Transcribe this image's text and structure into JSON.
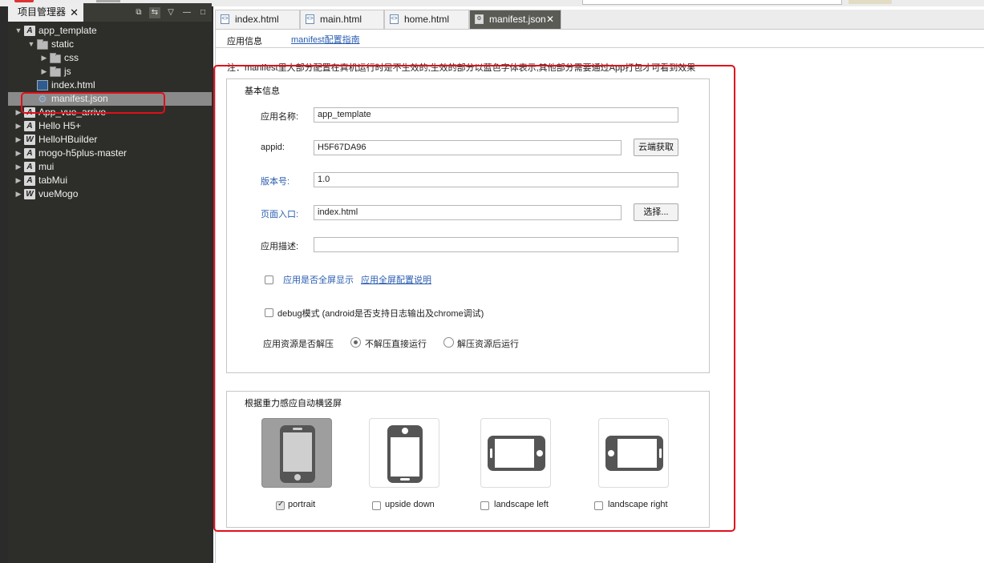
{
  "project_panel": {
    "title": "项目管理器",
    "tools": [
      "⧉",
      "⇆",
      "▽",
      "—",
      "□"
    ],
    "tree": [
      {
        "label": "app_template",
        "icon": "project-icon",
        "badge": "A",
        "expanded": true
      },
      {
        "label": "static",
        "icon": "folder-icon",
        "expanded": true
      },
      {
        "label": "css",
        "icon": "folder-icon",
        "expanded": false
      },
      {
        "label": "js",
        "icon": "folder-icon",
        "expanded": false
      },
      {
        "label": "index.html",
        "icon": "html-file-icon"
      },
      {
        "label": "manifest.json",
        "icon": "json-file-icon",
        "selected": true
      },
      {
        "label": "App_vue_arrive",
        "icon": "project-icon",
        "badge": "A",
        "expanded": false
      },
      {
        "label": "Hello H5+",
        "icon": "project-icon",
        "badge": "A",
        "expanded": false
      },
      {
        "label": "HelloHBuilder",
        "icon": "project-icon",
        "badge": "W",
        "expanded": false
      },
      {
        "label": "mogo-h5plus-master",
        "icon": "project-icon",
        "badge": "A",
        "expanded": false
      },
      {
        "label": "mui",
        "icon": "project-icon",
        "badge": "A",
        "expanded": false
      },
      {
        "label": "tabMui",
        "icon": "project-icon",
        "badge": "A",
        "expanded": false
      },
      {
        "label": "vueMogo",
        "icon": "project-icon",
        "badge": "W",
        "expanded": false
      }
    ]
  },
  "editor_tabs": [
    {
      "label": "index.html",
      "active": false
    },
    {
      "label": "main.html",
      "active": false
    },
    {
      "label": "home.html",
      "active": false
    },
    {
      "label": "manifest.json",
      "active": true,
      "close": "✕"
    }
  ],
  "manifest": {
    "subtab": "应用信息",
    "guide_link": "manifest配置指南",
    "note": "注：manifest里大部分配置在真机运行时是不生效的,生效的部分以蓝色字体表示,其他部分需要通过App打包才可看到效果",
    "basic": {
      "title": "基本信息",
      "app_name_label": "应用名称:",
      "app_name_value": "app_template",
      "appid_label": "appid:",
      "appid_value": "H5F67DA96",
      "cloud_button": "云端获取",
      "version_label": "版本号:",
      "version_value": "1.0",
      "entry_label": "页面入口:",
      "entry_value": "index.html",
      "choose_button": "选择...",
      "desc_label": "应用描述:",
      "desc_value": "",
      "fullscreen_label": "应用是否全屏显示",
      "fullscreen_checked": false,
      "fullscreen_link": "应用全屏配置说明",
      "debug_label": "debug模式 (android是否支持日志输出及chrome调试)",
      "debug_checked": false,
      "unzip_label": "应用资源是否解压",
      "unzip_options": [
        "不解压直接运行",
        "解压资源后运行"
      ],
      "unzip_selected": 0
    },
    "orientation": {
      "title": "根据重力感应自动横竖屏",
      "options": [
        {
          "label": "portrait",
          "checked": true
        },
        {
          "label": "upside down",
          "checked": false
        },
        {
          "label": "landscape left",
          "checked": false
        },
        {
          "label": "landscape right",
          "checked": false
        }
      ]
    }
  },
  "colors": {
    "highlight": "#e0101a",
    "blue_text": "#2a5db0",
    "panel_bg": "#2d2e29"
  }
}
